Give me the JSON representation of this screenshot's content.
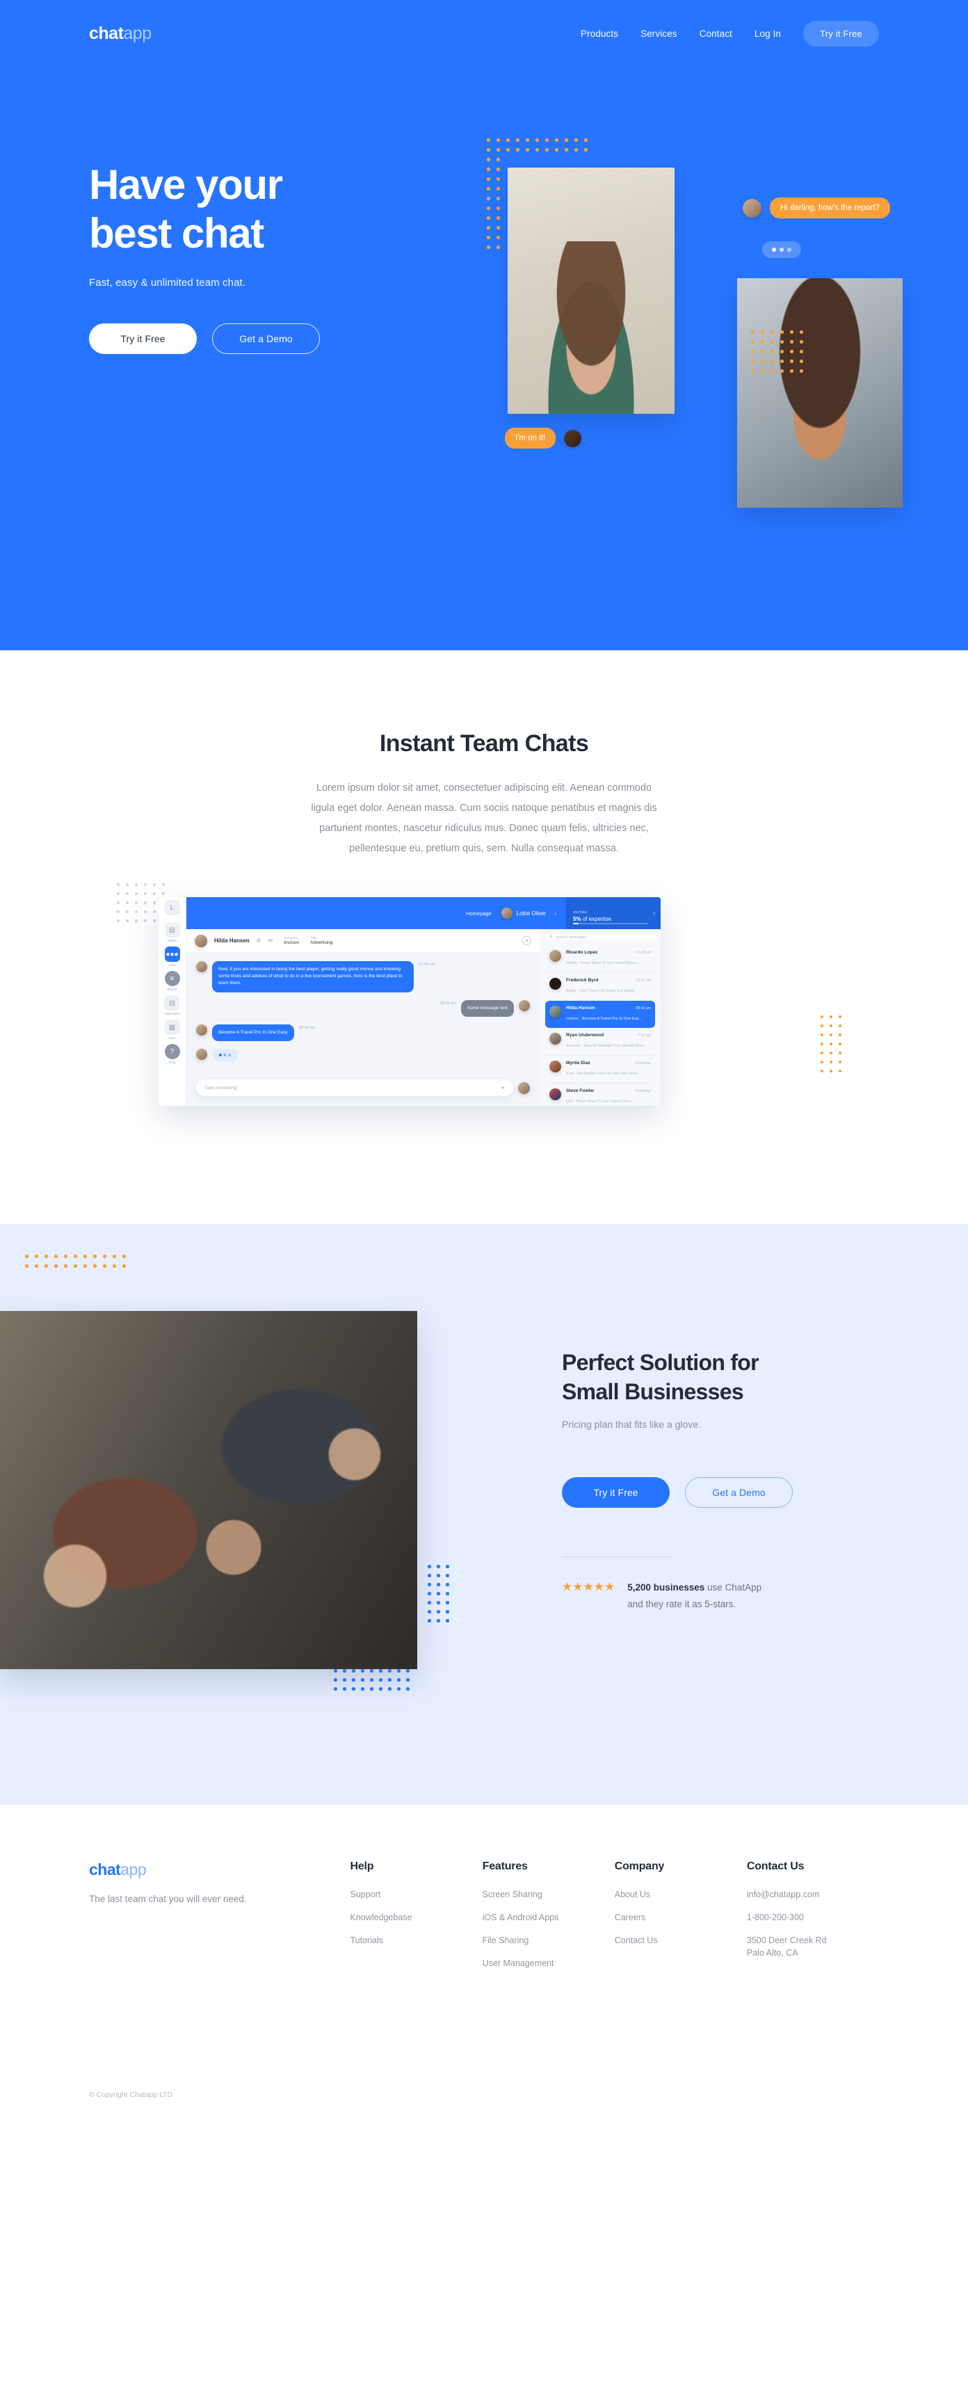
{
  "brand": {
    "name_bold": "chat",
    "name_light": "app",
    "accent": "#2775ff",
    "orange": "#f8a13a"
  },
  "nav": {
    "links": [
      "Products",
      "Services",
      "Contact",
      "Log In"
    ],
    "cta": "Try it Free"
  },
  "hero": {
    "title_line1": "Have your",
    "title_line2": "best chat",
    "subtitle": "Fast, easy & unlimited team chat.",
    "btn_primary": "Try it Free",
    "btn_secondary": "Get a Demo",
    "bubbles": [
      {
        "text": "Hi darling, how's the report?",
        "side": "in"
      },
      {
        "text": "I'm on it!",
        "side": "out"
      }
    ]
  },
  "section_instant": {
    "title": "Instant Team Chats",
    "paragraph": "Lorem ipsum dolor sit amet, consectetuer adipiscing elit. Aenean commodo ligula eget dolor. Aenean massa. Cum sociis natoque penatibus et magnis dis parturient montes, nascetur ridiculus mus. Donec quam felis, ultricies nec, pellentesque eu, pretium quis, sem. Nulla consequat massa."
  },
  "mockup": {
    "sidebar": [
      {
        "label": "Offers",
        "icon": "briefcase-icon",
        "active": false
      },
      {
        "label": "Chat",
        "icon": "chat-bubble-icon",
        "active": true
      },
      {
        "label": "Board",
        "icon": "sliders-icon",
        "active": false
      },
      {
        "label": "Application",
        "icon": "document-icon",
        "active": false
      },
      {
        "label": "Lists",
        "icon": "list-card-icon",
        "active": false
      },
      {
        "label": "FAQ",
        "icon": "question-icon",
        "active": false
      }
    ],
    "topbar": {
      "homepage": "Homepage",
      "user": "Lottie Oliver",
      "xp_label": "you have",
      "xp_percent": "5%",
      "xp_rest": " of expertise"
    },
    "chat_header": {
      "name": "Hilda Hansen",
      "company_key": "Company",
      "company_val": "Invision",
      "offer_key": "Offer",
      "offer_val": "Advertising"
    },
    "messages": [
      {
        "dir": "in",
        "text": "Now, if you are interested in being the best player, getting really good money and knowing some tricks and advices of what to do in a live tournament games, here is the best place to learn them.",
        "time": "07:44 am"
      },
      {
        "dir": "out",
        "text": "Some message text",
        "time": "08:43 am"
      },
      {
        "dir": "in",
        "text": "Become A Travel Pro In One Easy",
        "time": "08:43 am"
      },
      {
        "dir": "typing",
        "text": "",
        "time": ""
      }
    ],
    "input_placeholder": "Type something",
    "search_placeholder": "search messages",
    "contacts": [
      {
        "name": "Ricardo Lopez",
        "org": "Adobe",
        "time": "11:23 am",
        "preview": "Three Ways To Get Travel Disco...",
        "active": false
      },
      {
        "name": "Frederick Byrd",
        "org": "Apple",
        "time": "10:11 am",
        "preview": "Train Travel On Track For Safety",
        "active": false
      },
      {
        "name": "Hilda Hansen",
        "org": "Invision",
        "time": "08:43 am",
        "preview": "Become A Travel Pro In One Eas...",
        "active": true
      },
      {
        "name": "Ryan Underwood",
        "org": "Avocode",
        "time": "7:11 am",
        "preview": "How To Maintain Your Mental Heal...",
        "active": false
      },
      {
        "name": "Myrtie Diaz",
        "org": "Audi",
        "time": "Yesterday",
        "preview": "Get Ready Fast For Fall Leaf Viewi...",
        "active": false
      },
      {
        "name": "Steve Fowler",
        "org": "Dell",
        "time": "Yesterday",
        "preview": "Three Ways To Get Travel Disco...",
        "active": false
      }
    ]
  },
  "section_solution": {
    "title_line1": "Perfect Solution for",
    "title_line2": "Small Businesses",
    "subtitle": "Pricing plan that fits like a glove.",
    "btn_primary": "Try it Free",
    "btn_secondary": "Get a Demo",
    "stars": "★★★★★",
    "rating_bold": "5,200 businesses",
    "rating_rest": " use ChatApp",
    "rating_line2": "and they rate it as 5-stars."
  },
  "footer": {
    "tagline": "The last team chat you will ever need.",
    "columns": [
      {
        "title": "Help",
        "items": [
          "Support",
          "Knowledgebase",
          "Tutorials"
        ]
      },
      {
        "title": "Features",
        "items": [
          "Screen Sharing",
          "iOS & Android Apps",
          "File Sharing",
          "User Management"
        ]
      },
      {
        "title": "Company",
        "items": [
          "About Us",
          "Careers",
          "Contact Us"
        ]
      },
      {
        "title": "Contact Us",
        "items": [
          "info@chatapp.com",
          "1-800-200-300",
          "3500 Deer Creek Rd Palo Alto, CA"
        ]
      }
    ],
    "copyright": "© Copyright Chatapp LTD"
  }
}
